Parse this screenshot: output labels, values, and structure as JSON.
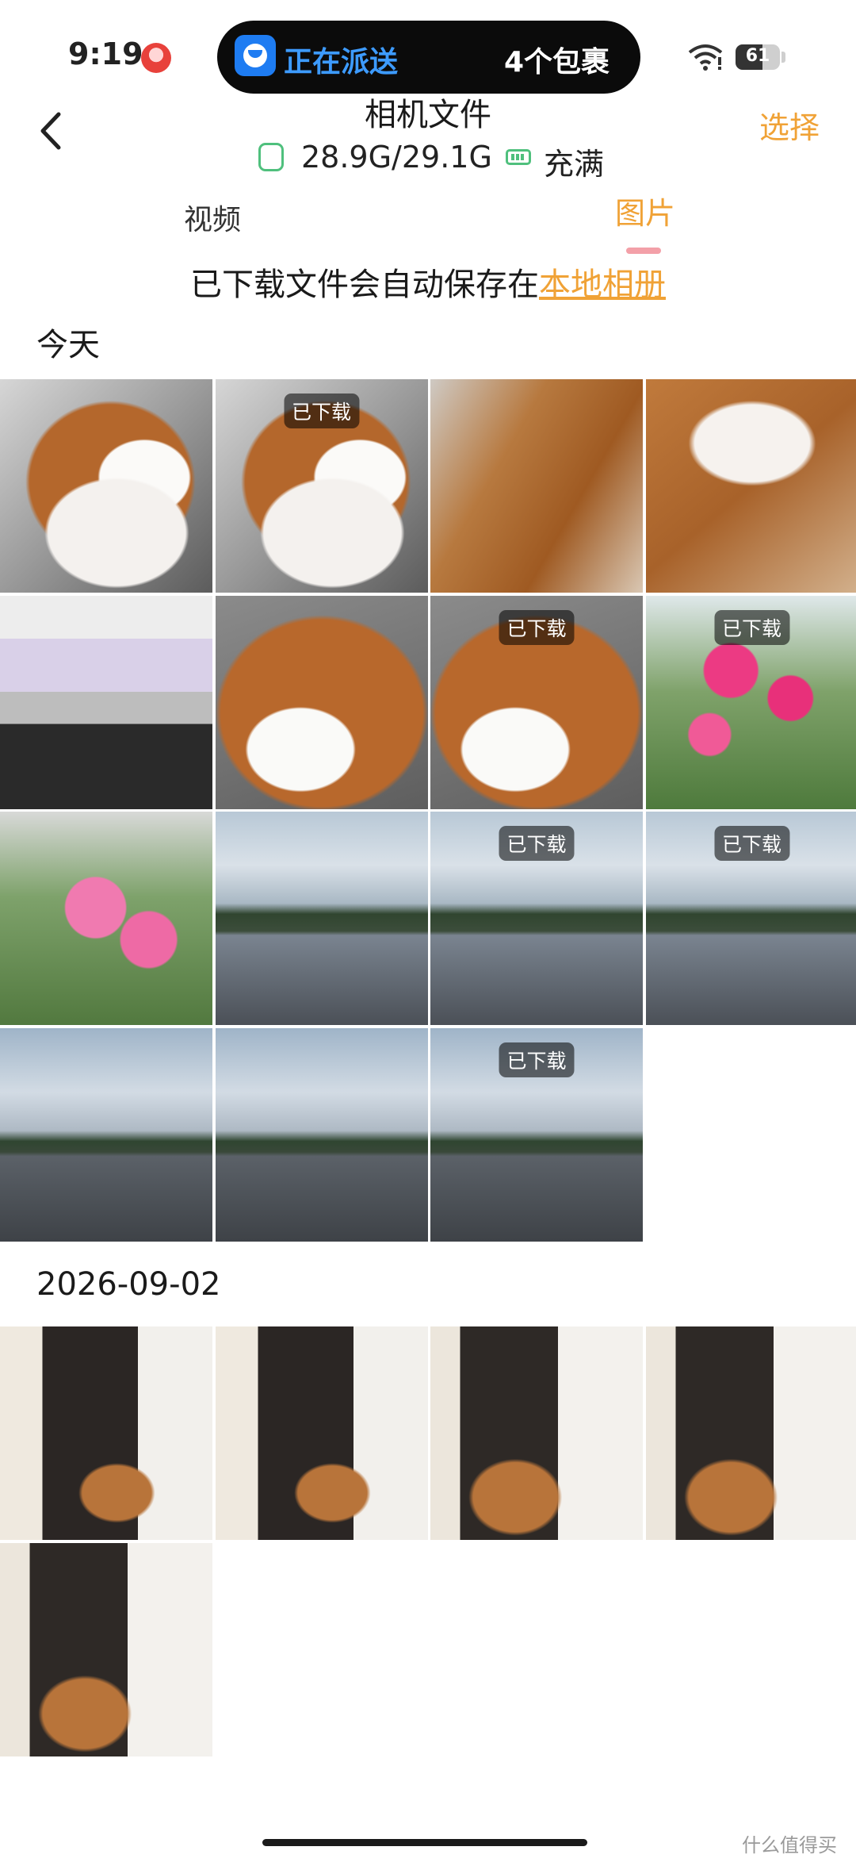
{
  "status_bar": {
    "time": "9:19",
    "island_status": "正在派送",
    "island_count": "4个包裹",
    "battery": "61",
    "battery_level_percent": 61
  },
  "header": {
    "title": "相机文件",
    "select_label": "选择",
    "storage": "28.9G/29.1G",
    "charge_status": "充满"
  },
  "tabs": [
    {
      "label": "视频",
      "active": false
    },
    {
      "label": "图片",
      "active": true
    }
  ],
  "notice": {
    "text": "已下载文件会自动保存在",
    "link": "本地相册"
  },
  "sections": [
    {
      "title": "今天",
      "photos": [
        {
          "kind": "corgi",
          "downloaded": false
        },
        {
          "kind": "corgi",
          "downloaded": true
        },
        {
          "kind": "corgi-blur",
          "downloaded": false
        },
        {
          "kind": "corgi-blur2",
          "downloaded": false
        },
        {
          "kind": "screen",
          "downloaded": false
        },
        {
          "kind": "corgi-close",
          "downloaded": false
        },
        {
          "kind": "corgi-close",
          "downloaded": true
        },
        {
          "kind": "flower",
          "downloaded": true
        },
        {
          "kind": "flower2",
          "downloaded": false
        },
        {
          "kind": "lake",
          "downloaded": false
        },
        {
          "kind": "lake",
          "downloaded": true
        },
        {
          "kind": "lake",
          "downloaded": true
        },
        {
          "kind": "lake2",
          "downloaded": false
        },
        {
          "kind": "lake2",
          "downloaded": false
        },
        {
          "kind": "lake2",
          "downloaded": true
        }
      ]
    },
    {
      "title": "2026-09-02",
      "photos": [
        {
          "kind": "room",
          "downloaded": false
        },
        {
          "kind": "room",
          "downloaded": false
        },
        {
          "kind": "room2",
          "downloaded": false
        },
        {
          "kind": "room2",
          "downloaded": false
        },
        {
          "kind": "room2",
          "downloaded": false
        }
      ]
    }
  ],
  "badge_label": "已下载",
  "watermark": "什么值得买",
  "colors": {
    "accent": "#f0a236",
    "green": "#4fc07d",
    "tab_indicator": "#f3a0a8"
  }
}
